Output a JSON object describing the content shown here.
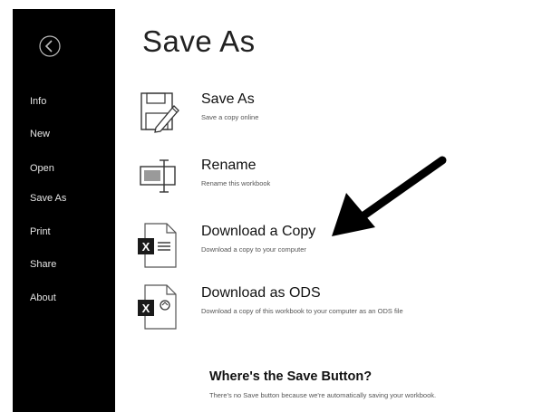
{
  "page": {
    "title": "Save As"
  },
  "sidebar": {
    "items": [
      {
        "label": "Info"
      },
      {
        "label": "New"
      },
      {
        "label": "Open"
      },
      {
        "label": "Save As"
      },
      {
        "label": "Print"
      },
      {
        "label": "Share"
      },
      {
        "label": "About"
      }
    ]
  },
  "options": [
    {
      "label": "Save As",
      "description": "Save a copy online",
      "icon": "save-as-icon"
    },
    {
      "label": "Rename",
      "description": "Rename this workbook",
      "icon": "rename-icon"
    },
    {
      "label": "Download a Copy",
      "description": "Download a copy to your computer",
      "icon": "excel-file-icon"
    },
    {
      "label": "Download as ODS",
      "description": "Download a copy of this workbook to your computer as an ODS file",
      "icon": "ods-file-icon"
    }
  ],
  "save_note": {
    "title": "Where's the Save Button?",
    "description": "There's no Save button because we're automatically saving your workbook."
  },
  "colors": {
    "sidebar_bg": "#000000",
    "sidebar_text": "#e4e4e4",
    "excel_icon": "#1a1a1a"
  }
}
